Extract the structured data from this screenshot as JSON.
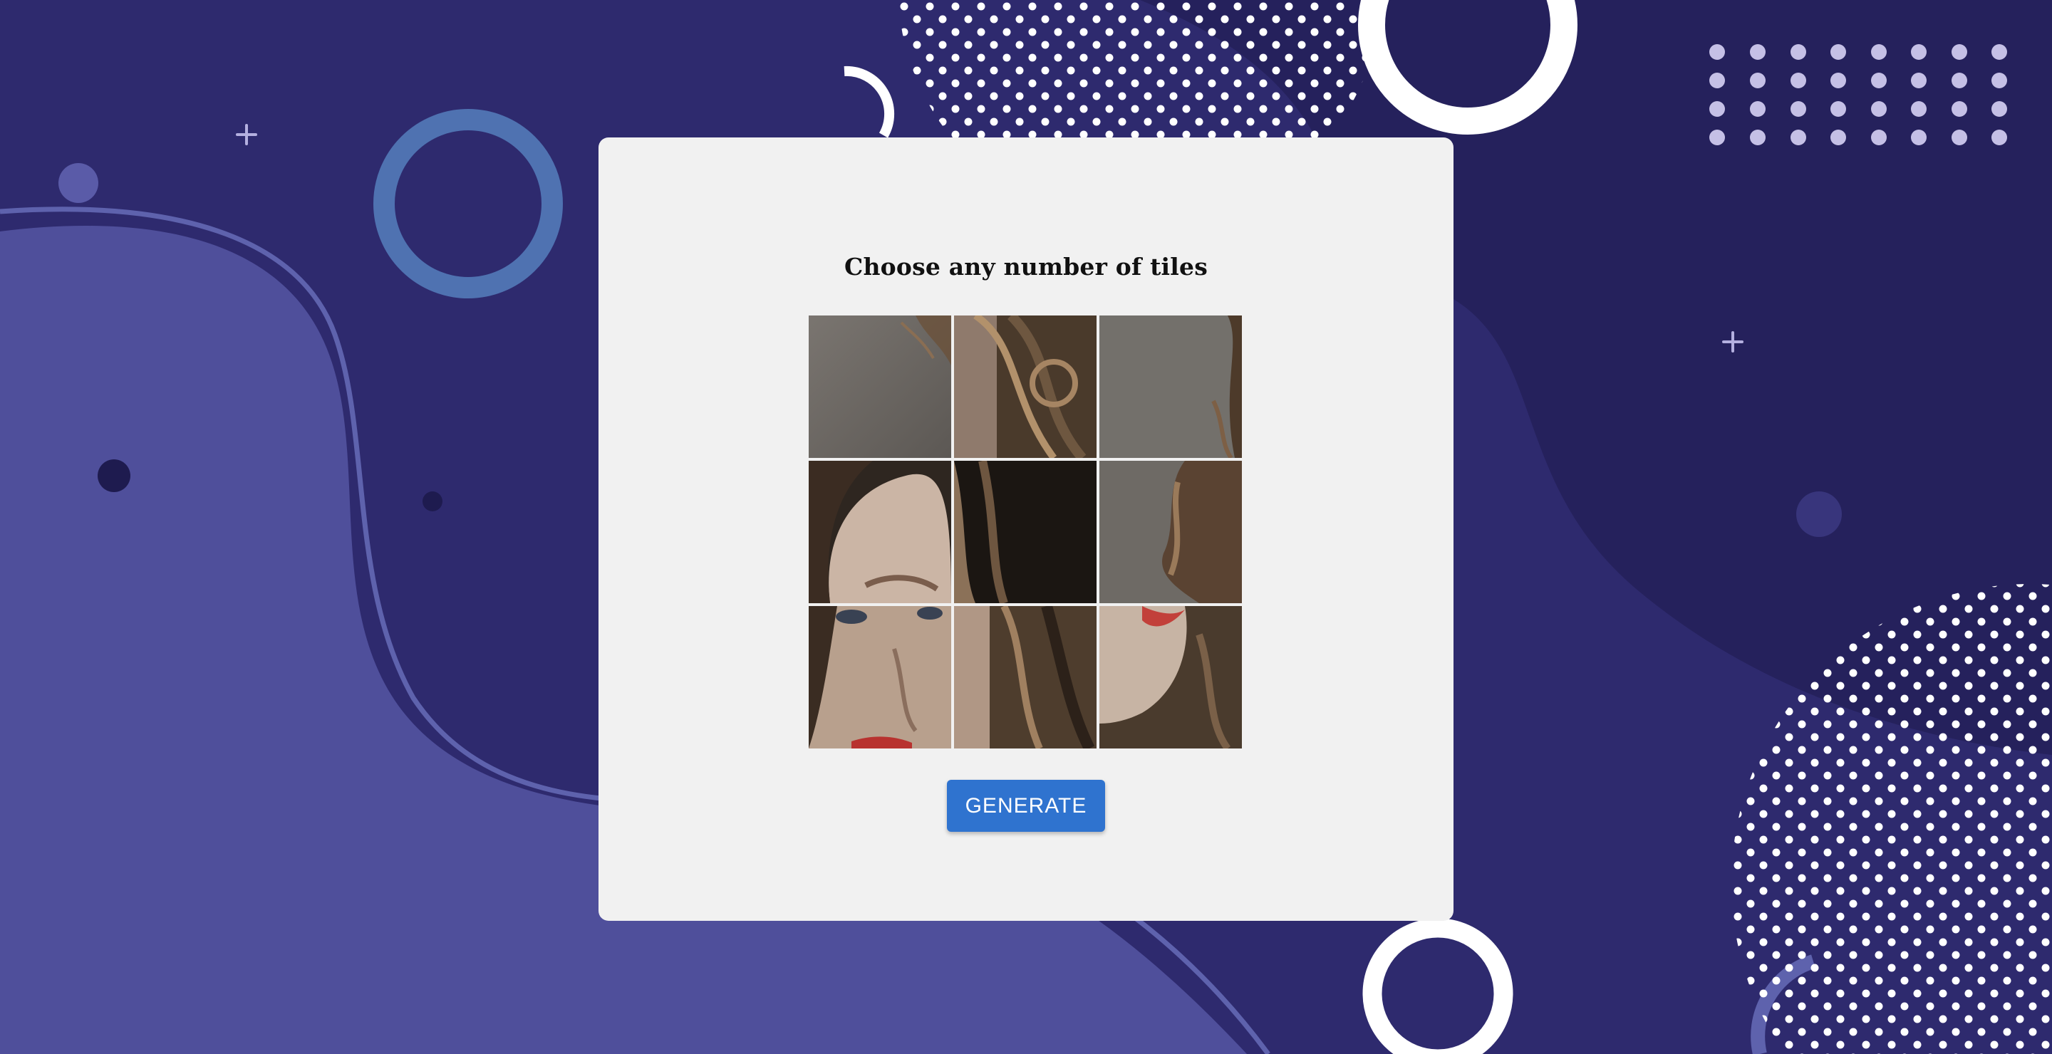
{
  "page": {
    "heading": "Choose any number of tiles",
    "generate_label": "GENERATE"
  },
  "tiles": [
    {
      "row": 1,
      "col": 1
    },
    {
      "row": 1,
      "col": 2
    },
    {
      "row": 1,
      "col": 3
    },
    {
      "row": 2,
      "col": 1
    },
    {
      "row": 2,
      "col": 2
    },
    {
      "row": 2,
      "col": 3
    },
    {
      "row": 3,
      "col": 1
    },
    {
      "row": 3,
      "col": 2
    },
    {
      "row": 3,
      "col": 3
    }
  ],
  "colors": {
    "background": "#2e2a6e",
    "card": "#f1f1f1",
    "button": "#2f73cf",
    "button_text": "#ffffff"
  }
}
